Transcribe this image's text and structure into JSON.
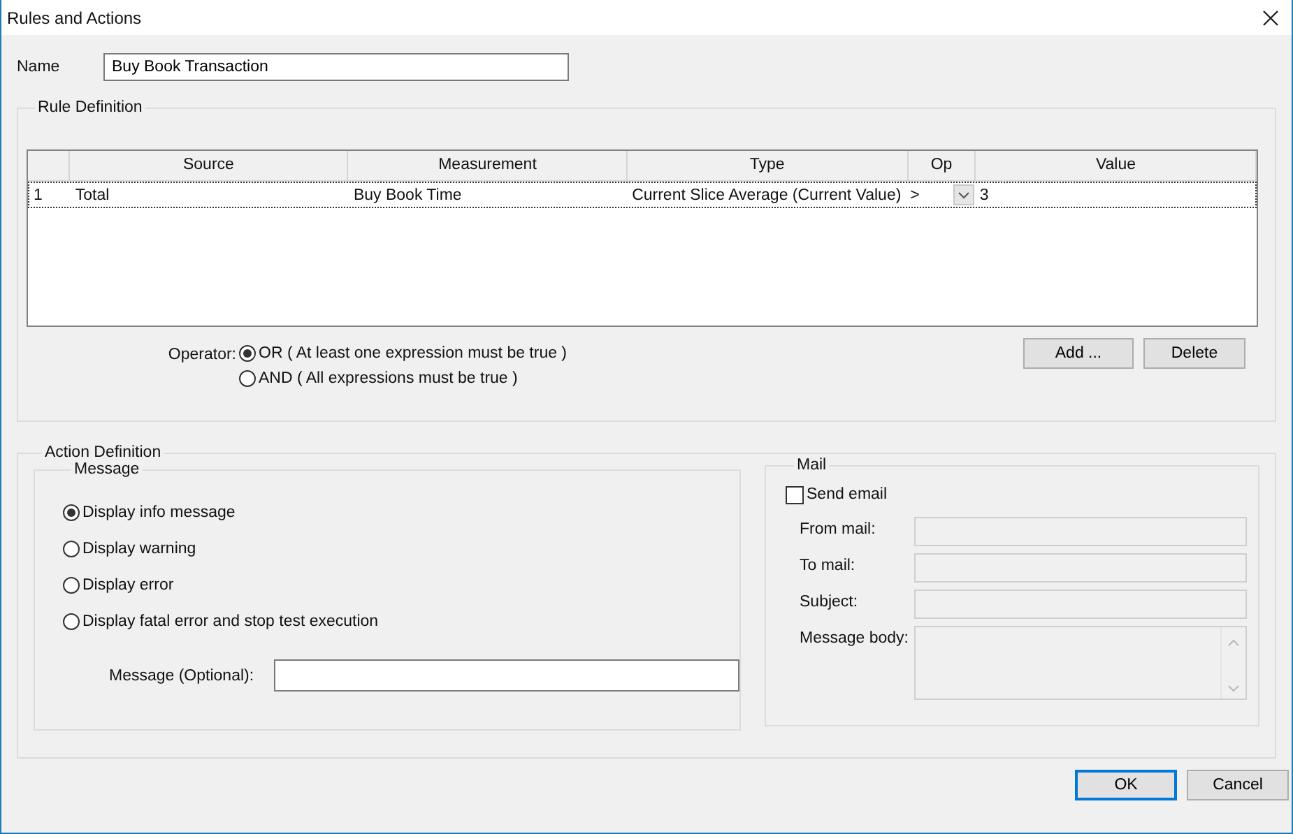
{
  "window": {
    "title": "Rules and Actions"
  },
  "name": {
    "label": "Name",
    "value": "Buy Book Transaction"
  },
  "rule_definition": {
    "title": "Rule Definition",
    "table": {
      "columns": [
        "Source",
        "Measurement",
        "Type",
        "Op",
        "Value"
      ],
      "rows": [
        {
          "number": "1",
          "source": "Total",
          "measurement": "Buy Book Time",
          "type": "Current Slice Average (Current Value)",
          "op": ">",
          "value": "3",
          "selected": true
        }
      ]
    },
    "operator": {
      "label": "Operator:",
      "options": [
        {
          "label": "OR ( At least one expression must be true )",
          "selected": true
        },
        {
          "label": "AND ( All expressions must be true )",
          "selected": false
        }
      ]
    },
    "buttons": [
      "Add ...",
      "Delete"
    ]
  },
  "action_definition": {
    "title": "Action Definition",
    "message": {
      "title": "Message",
      "options": [
        {
          "label": "Display info message",
          "selected": true
        },
        {
          "label": "Display warning",
          "selected": false
        },
        {
          "label": "Display error",
          "selected": false
        },
        {
          "label": "Display fatal error and stop test execution",
          "selected": false
        }
      ],
      "field_label": "Message (Optional):"
    },
    "mail": {
      "title": "Mail",
      "send_email": {
        "label": "Send email",
        "checked": false
      },
      "fields": [
        {
          "label": "From mail:",
          "kind": "line",
          "disabled": true
        },
        {
          "label": "To mail:",
          "kind": "line",
          "disabled": true
        },
        {
          "label": "Subject:",
          "kind": "line",
          "disabled": true
        },
        {
          "label": "Message body:",
          "kind": "area",
          "disabled": true
        }
      ]
    }
  },
  "buttons": [
    {
      "label": "OK",
      "default": true
    },
    {
      "label": "Cancel",
      "default": false
    }
  ]
}
